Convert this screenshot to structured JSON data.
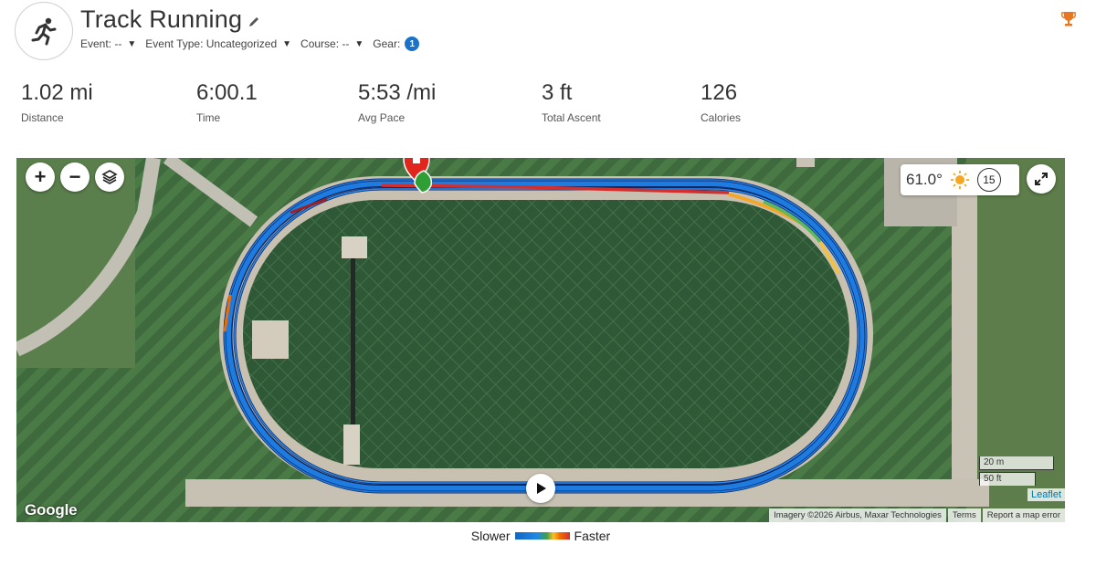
{
  "activity": {
    "title": "Track Running",
    "event": "Event: --",
    "event_type": "Event Type: Uncategorized",
    "course": "Course: --",
    "gear_label": "Gear:",
    "gear_count": "1"
  },
  "stats": [
    {
      "value": "1.02 mi",
      "label": "Distance"
    },
    {
      "value": "6:00.1",
      "label": "Time"
    },
    {
      "value": "5:53 /mi",
      "label": "Avg Pace"
    },
    {
      "value": "3 ft",
      "label": "Total Ascent"
    },
    {
      "value": "126",
      "label": "Calories"
    }
  ],
  "map": {
    "zoom_in": "+",
    "zoom_out": "−",
    "temperature": "61.0°",
    "wind_speed": "15",
    "scale_metric": "20 m",
    "scale_imperial": "50 ft",
    "leaflet_link": "Leaflet",
    "google_logo": "Google",
    "attribution": {
      "imagery": "Imagery ©2026 Airbus, Maxar Technologies",
      "terms": "Terms",
      "report": "Report a map error"
    },
    "icons": [
      "zoom-in-icon",
      "zoom-out-icon",
      "layers-icon",
      "sun-icon",
      "expand-icon",
      "play-icon",
      "start-marker-icon",
      "finish-marker-icon"
    ]
  },
  "legend": {
    "slower": "Slower",
    "faster": "Faster"
  },
  "colors": {
    "accent_blue": "#1a73c8",
    "route_blue": "#1e7be0",
    "trophy": "#e87722",
    "start_green": "#2e9e35",
    "finish_red": "#e0261d"
  }
}
